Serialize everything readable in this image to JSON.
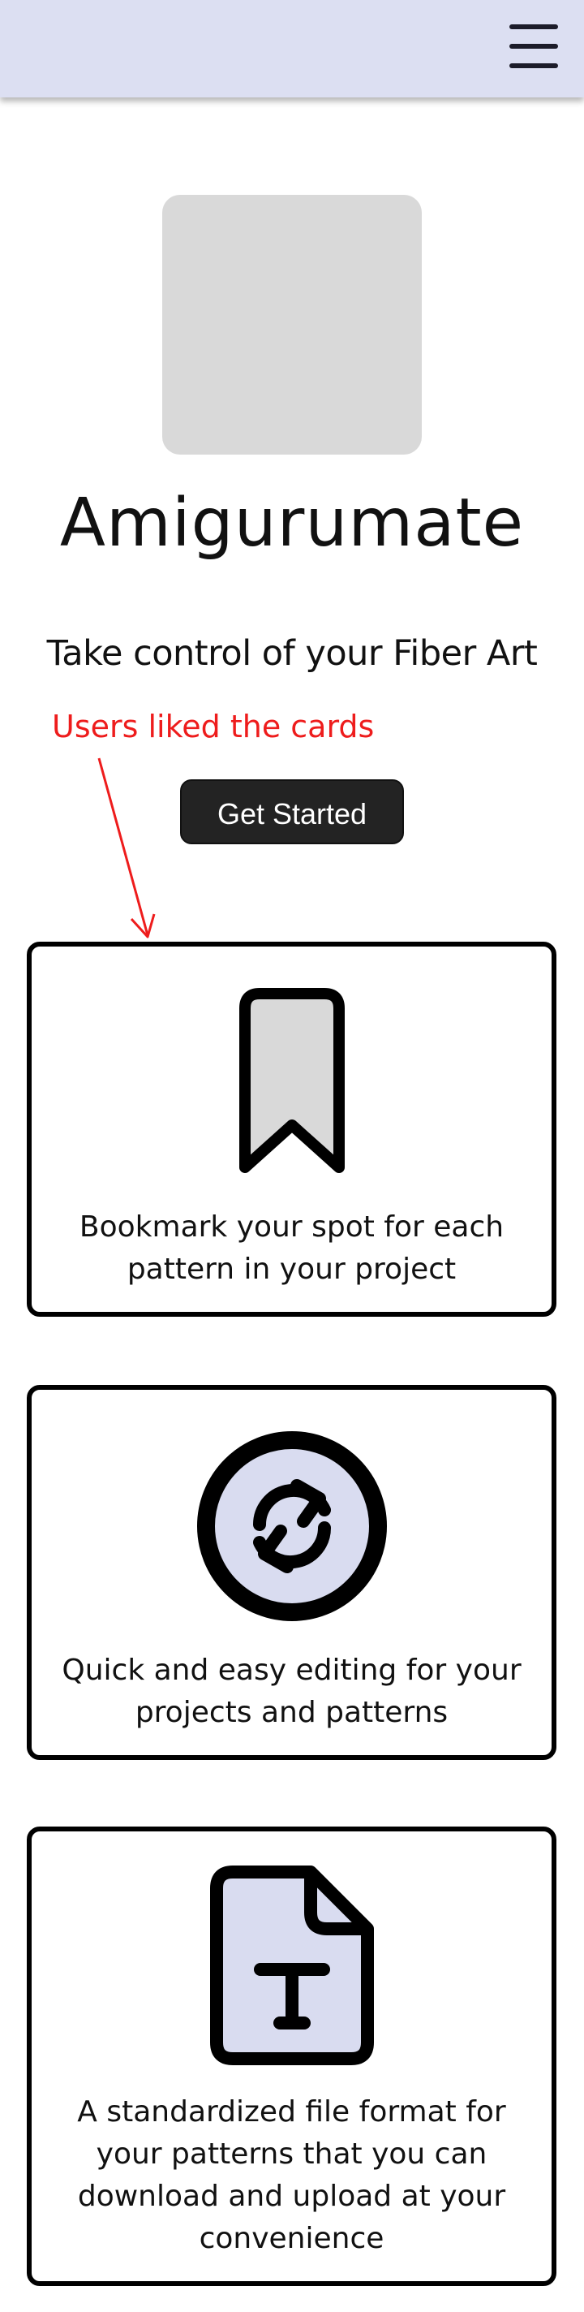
{
  "header": {
    "menu_icon": "hamburger-menu-icon",
    "background_color": "#dcdff2"
  },
  "hero": {
    "logo": "logo-placeholder",
    "title": "Amigurumate",
    "tagline": "Take control of your Fiber Art",
    "annotation": "Users liked the cards",
    "annotation_color": "#ee1c1c",
    "cta_label": "Get Started"
  },
  "features": [
    {
      "icon": "bookmark-icon",
      "text": "Bookmark your spot for each pattern in your project"
    },
    {
      "icon": "sync-icon",
      "text": "Quick and easy editing for your projects and patterns"
    },
    {
      "icon": "text-file-icon",
      "text": "A standardized file format for your patterns that you can download and upload at your convenience"
    }
  ],
  "colors": {
    "icon_fill_light": "#d9dcf0",
    "bookmark_fill": "#d9d9d9",
    "button_bg": "#232323"
  }
}
